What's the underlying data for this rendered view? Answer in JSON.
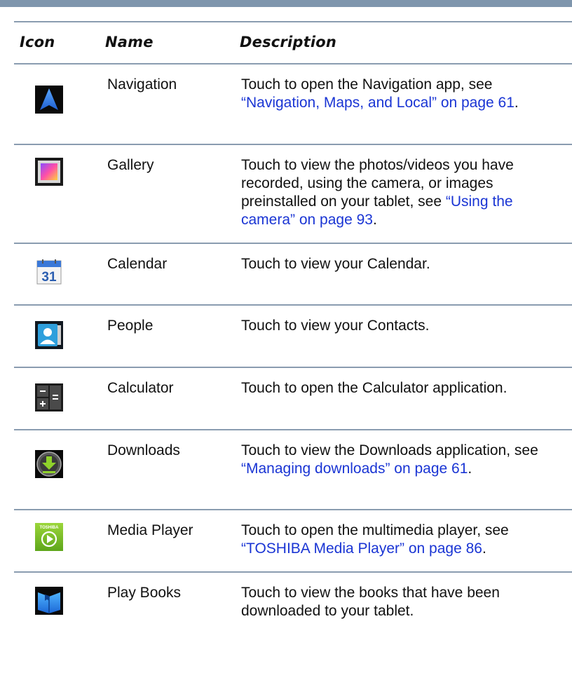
{
  "header": {
    "icon": "Icon",
    "name": "Name",
    "description": "Description"
  },
  "rows": [
    {
      "icon": "navigation-icon",
      "name": "Navigation",
      "desc": "Touch to open the Navigation app, see ",
      "link": "“Navigation, Maps, and Local” on page 61",
      "tail": "."
    },
    {
      "icon": "gallery-icon",
      "name": "Gallery",
      "desc": "Touch to view the photos/videos you have recorded, using the camera, or images preinstalled on your tablet, see ",
      "link": "“Using the camera” on page 93",
      "tail": "."
    },
    {
      "icon": "calendar-icon",
      "name": "Calendar",
      "desc": "Touch to view your Calendar.",
      "calendar_day": "31"
    },
    {
      "icon": "people-icon",
      "name": "People",
      "desc": "Touch to view your Contacts."
    },
    {
      "icon": "calculator-icon",
      "name": "Calculator",
      "desc": "Touch to open the Calculator application."
    },
    {
      "icon": "downloads-icon",
      "name": "Downloads",
      "desc": "Touch to view the Downloads application, see ",
      "link": "“Managing downloads” on page 61",
      "tail": "."
    },
    {
      "icon": "media-player-icon",
      "name": "Media Player",
      "desc": "Touch to open the multimedia player, see ",
      "link": "“TOSHIBA Media Player” on page 86",
      "tail": ".",
      "icon_label": "TOSHIBA"
    },
    {
      "icon": "play-books-icon",
      "name": "Play Books",
      "desc": "Touch to view the books that have been downloaded to your tablet."
    }
  ]
}
